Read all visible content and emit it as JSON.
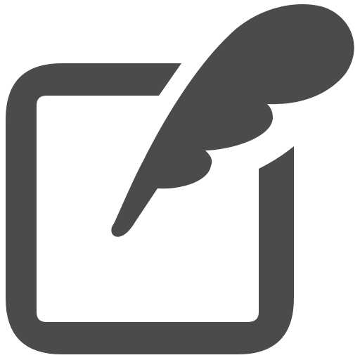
{
  "icon": {
    "name": "edit-note-icon",
    "color": "#4b4b4b",
    "background": "#ffffff",
    "parts": [
      "square-frame",
      "quill-feather"
    ]
  }
}
